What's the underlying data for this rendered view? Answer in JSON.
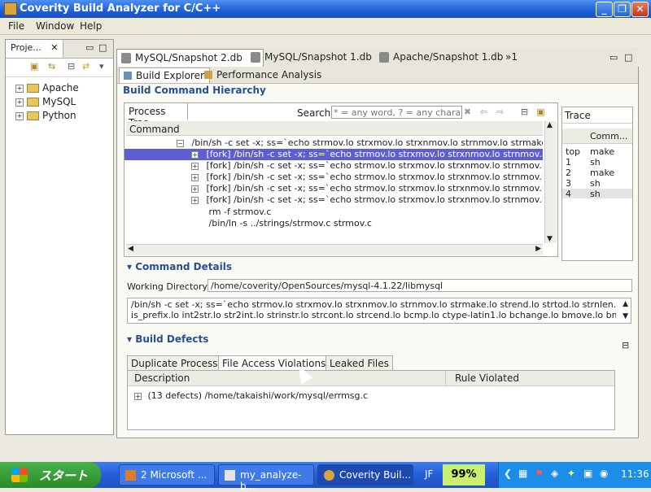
{
  "window": {
    "title": "Coverity Build Analyzer for C/C++"
  },
  "menu": {
    "file": "File",
    "window": "Window",
    "help": "Help"
  },
  "project_panel": {
    "tab_label": "Proje...",
    "items": [
      {
        "label": "Apache"
      },
      {
        "label": "MySQL"
      },
      {
        "label": "Python"
      }
    ]
  },
  "editor_tabs": [
    {
      "label": "MySQL/Snapshot 2.db"
    },
    {
      "label": "MySQL/Snapshot 1.db"
    },
    {
      "label": "Apache/Snapshot 1.db"
    },
    {
      "label": "»1"
    }
  ],
  "sub_tabs": {
    "build_explorer": "Build Explorer",
    "performance": "Performance Analysis"
  },
  "hierarchy": {
    "title": "Build Command Hierarchy",
    "process_tree_label": "Process Tree",
    "search_label": "Search:",
    "search_placeholder": "* = any word, ? = any character",
    "column_command": "Command",
    "rows": [
      {
        "text": "/bin/sh -c set -x;  ss=`echo strmov.lo strxmov.lo strxnmov.lo strnmov.lo strmake.lo stre"
      },
      {
        "text": "[fork]     /bin/sh -c set -x;  ss=`echo strmov.lo strxmov.lo strxnmov.lo strnmov.lo str"
      },
      {
        "text": "[fork]     /bin/sh -c set -x;  ss=`echo strmov.lo strxmov.lo strxnmov.lo strnmov.lo str"
      },
      {
        "text": "[fork]     /bin/sh -c set -x;  ss=`echo strmov.lo strxmov.lo strxnmov.lo strnmov.lo str"
      },
      {
        "text": "[fork]     /bin/sh -c set -x;  ss=`echo strmov.lo strxmov.lo strxnmov.lo strnmov.lo str"
      },
      {
        "text": "[fork]     /bin/sh -c set -x;  ss=`echo strmov.lo strxmov.lo strxnmov.lo strnmov.lo str"
      },
      {
        "text": "rm -f strmov.c"
      },
      {
        "text": "/bin/ln -s ../strings/strmov.c strmov.c"
      }
    ]
  },
  "trace": {
    "title": "Trace",
    "column_command": "Comm...",
    "rows": [
      {
        "level": "top",
        "cmd": "make"
      },
      {
        "level": "1",
        "cmd": "sh"
      },
      {
        "level": "2",
        "cmd": "make"
      },
      {
        "level": "3",
        "cmd": "sh"
      },
      {
        "level": "4",
        "cmd": "sh"
      }
    ]
  },
  "command_details": {
    "title": "Command Details",
    "wdir_label": "Working Directory:",
    "wdir_value": "/home/coverity/OpenSources/mysql-4.1.22/libmysql",
    "command_line1": "/bin/sh -c set -x;  ss=`echo strmov.lo strxmov.lo strxnmov.lo strnmov.lo strmake.lo strend.lo strtod.lo strnlen.lo strfill.lo",
    "command_line2": "is_prefix.lo int2str.lo str2int.lo strinstr.lo strcont.lo strcend.lo bcmp.lo ctype-latin1.lo bchange.lo bmove.lo bmove_upp.lo"
  },
  "build_defects": {
    "title": "Build Defects",
    "tabs": [
      {
        "label": "Duplicate Processes"
      },
      {
        "label": "File Access Violations"
      },
      {
        "label": "Leaked Files"
      }
    ],
    "col_description": "Description",
    "col_rule": "Rule Violated",
    "row": "(13 defects) /home/takaishi/work/mysql/errmsg.c"
  },
  "taskbar": {
    "start": "スタート",
    "tasks": [
      {
        "label": "2 Microsoft ..."
      },
      {
        "label": "my_analyze-b..."
      },
      {
        "label": "Coverity Buil..."
      }
    ],
    "lang": "JF",
    "battery": "99%",
    "clock": "11:36"
  }
}
